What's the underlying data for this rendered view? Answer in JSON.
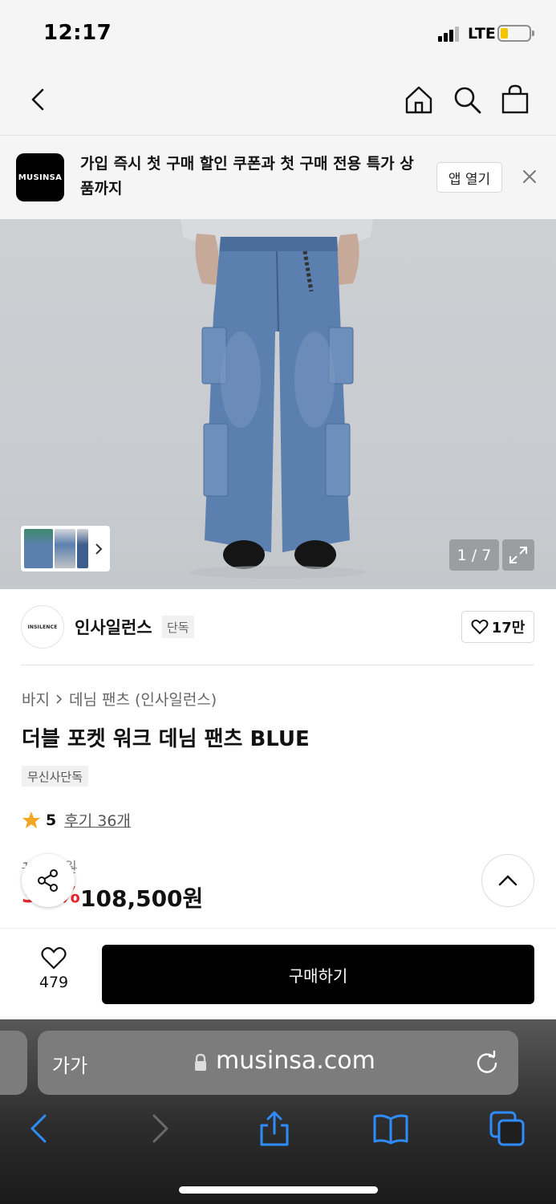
{
  "status_bar": {
    "time": "12:17",
    "network": "LTE",
    "battery_color": "#f2c500"
  },
  "nav": {
    "back_icon": "chevron-left-icon",
    "home_icon": "home-icon",
    "search_icon": "search-icon",
    "cart_icon": "shopping-bag-icon"
  },
  "banner": {
    "logo_text": "MUSINSA",
    "message": "가입 즉시 첫 구매 할인 쿠폰과 첫 구매 전용 특가 상품까지",
    "open_app_label": "앱 열기",
    "close_icon": "close-icon"
  },
  "gallery": {
    "counter": "1 / 7",
    "expand_icon": "expand-icon",
    "thumbs_arrow": "chevron-right-icon"
  },
  "brand": {
    "logo_text": "INSILENCE",
    "name": "인사일런스",
    "tag": "단독",
    "likes": "17만"
  },
  "product": {
    "breadcrumb": [
      "바지",
      "데님 팬츠 (인사일런스)"
    ],
    "title": "더블 포켓 워크 데님 팬츠 BLUE",
    "badge": "무신사단독",
    "rating": "5",
    "reviews": "후기 36개",
    "original_price": "1…00원",
    "discount": "3…%",
    "price": "108,500원",
    "discount_color": "#e3262c"
  },
  "floating": {
    "share_icon": "share-icon",
    "top_icon": "chevron-up-icon"
  },
  "purchase_bar": {
    "wish_count": "479",
    "buy_label": "구매하기"
  },
  "safari": {
    "aa_label": "가가",
    "url": "musinsa.com"
  }
}
